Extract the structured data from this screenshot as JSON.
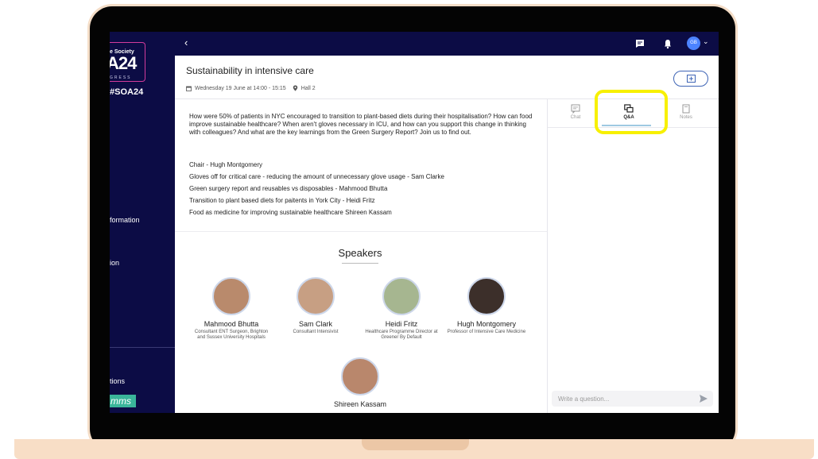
{
  "brand": {
    "society": "e Society",
    "year": "A24",
    "congress": "GRESS",
    "hashtag": "#SOA24",
    "accent": "#d33b9b"
  },
  "sidebar": {
    "items": [
      {
        "label": "formation"
      },
      {
        "label": "ion"
      },
      {
        "label": "tions"
      }
    ],
    "footer_logo": "mms",
    "footer_color": "#3ab59a"
  },
  "topbar": {
    "back_label": "‹",
    "avatar_initials": "GB",
    "bg": "#0c0c45"
  },
  "session": {
    "title": "Sustainability in intensive care",
    "date": "Wednesday 19 June at 14:00 - 15:15",
    "location": "Hall 2"
  },
  "description": "How were 50% of patients in NYC encouraged to transition to plant-based diets during their hospitalisation? How can food improve sustainable healthcare? When aren't gloves necessary in ICU, and how can you support this change in thinking with colleagues? And what are the key learnings from the Green Surgery Report? Join us to find out.",
  "agenda": [
    "Chair - Hugh Montgomery",
    "Gloves off for critical care - reducing the amount of unnecessary glove usage - Sam Clarke",
    "Green surgery report and reusables vs disposables - Mahmood Bhutta",
    "Transition to plant based diets for paitents in York City - Heidi Fritz",
    "Food as medicine for improving sustainable healthcare Shireen Kassam"
  ],
  "speakers": {
    "title": "Speakers",
    "list": [
      {
        "name": "Mahmood Bhutta",
        "role": "Consultant ENT Surgeon, Brighton and Sussex University Hospitals"
      },
      {
        "name": "Sam Clark",
        "role": "Consultant Intensivist"
      },
      {
        "name": "Heidi Fritz",
        "role": "Healthcare Programme Director at Greener By Default"
      },
      {
        "name": "Hugh Montgomery",
        "role": "Professor of Intensive Care Medicine"
      },
      {
        "name": "Shireen Kassam",
        "role": ""
      }
    ]
  },
  "tabs": [
    {
      "label": "Chat",
      "icon": "chat-icon"
    },
    {
      "label": "Q&A",
      "icon": "qa-icon",
      "active": true
    },
    {
      "label": "Notes",
      "icon": "notes-icon"
    }
  ],
  "qa": {
    "placeholder": "Write a question...",
    "highlight_color": "#f7f002"
  }
}
